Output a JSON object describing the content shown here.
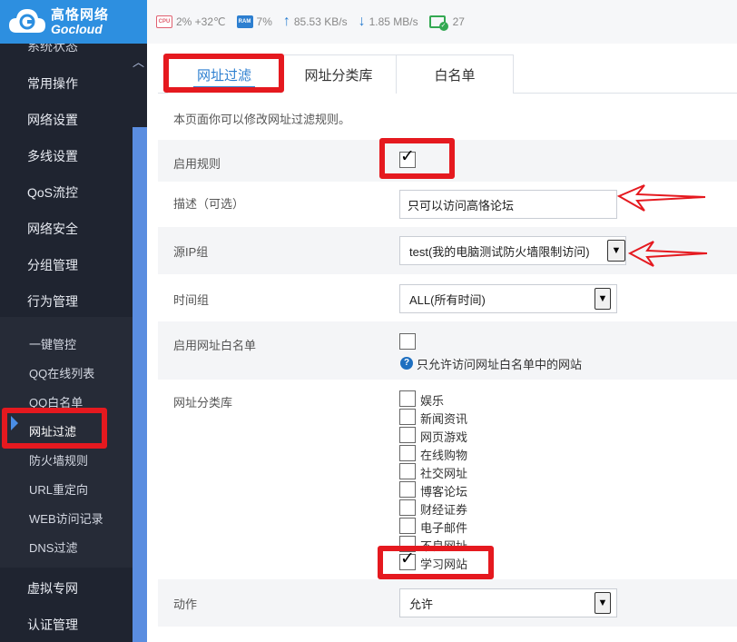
{
  "brand": {
    "name_cn": "高恪网络",
    "name_en": "Gocloud"
  },
  "status": {
    "cpu_icon": "CPU",
    "cpu": "2% +32℃",
    "ram_icon": "RAM",
    "ram": "7%",
    "upload": "85.53 KB/s",
    "download": "1.85 MB/s",
    "online": "27"
  },
  "sidebar": {
    "items": [
      {
        "label": "系统状态"
      },
      {
        "label": "常用操作"
      },
      {
        "label": "网络设置"
      },
      {
        "label": "多线设置"
      },
      {
        "label": "QoS流控"
      },
      {
        "label": "网络安全"
      },
      {
        "label": "分组管理"
      },
      {
        "label": "行为管理"
      }
    ],
    "subitems": [
      {
        "label": "一键管控"
      },
      {
        "label": "QQ在线列表"
      },
      {
        "label": "QQ白名单"
      },
      {
        "label": "网址过滤"
      },
      {
        "label": "防火墙规则"
      },
      {
        "label": "URL重定向"
      },
      {
        "label": "WEB访问记录"
      },
      {
        "label": "DNS过滤"
      }
    ],
    "active_subitem": "网址过滤",
    "bottom_items": [
      {
        "label": "虚拟专网"
      },
      {
        "label": "认证管理"
      }
    ]
  },
  "tabs": [
    {
      "label": "网址过滤",
      "active": true
    },
    {
      "label": "网址分类库",
      "active": false
    },
    {
      "label": "白名单",
      "active": false
    }
  ],
  "page_description": "本页面你可以修改网址过滤规则。",
  "form": {
    "enable_rule": {
      "label": "启用规则",
      "checked": true
    },
    "description": {
      "label": "描述（可选）",
      "value": "只可以访问高恪论坛"
    },
    "source_ip_group": {
      "label": "源IP组",
      "value": "test(我的电脑测试防火墙限制访问)"
    },
    "time_group": {
      "label": "时间组",
      "value": "ALL(所有时间)"
    },
    "url_whitelist": {
      "label": "启用网址白名单",
      "checked": false,
      "help": "只允许访问网址白名单中的网站"
    },
    "category": {
      "label": "网址分类库",
      "options": [
        {
          "label": "娱乐",
          "checked": false
        },
        {
          "label": "新闻资讯",
          "checked": false
        },
        {
          "label": "网页游戏",
          "checked": false
        },
        {
          "label": "在线购物",
          "checked": false
        },
        {
          "label": "社交网址",
          "checked": false
        },
        {
          "label": "博客论坛",
          "checked": false
        },
        {
          "label": "财经证券",
          "checked": false
        },
        {
          "label": "电子邮件",
          "checked": false
        },
        {
          "label": "不良网址",
          "checked": false
        },
        {
          "label": "学习网站",
          "checked": true
        }
      ]
    },
    "action": {
      "label": "动作",
      "value": "允许"
    }
  },
  "icons": {
    "cpu": "cpu-chip-icon",
    "ram": "ram-chip-icon",
    "upload": "arrow-up-icon",
    "download": "arrow-down-icon",
    "online": "monitor-check-icon",
    "help": "question-circle-icon",
    "select": "chevron-down-icon"
  },
  "colors": {
    "brand_blue": "#2d8fe0",
    "sidebar_bg": "#1f2430",
    "accent": "#2d7fd0",
    "annotation_red": "#e5191f"
  }
}
